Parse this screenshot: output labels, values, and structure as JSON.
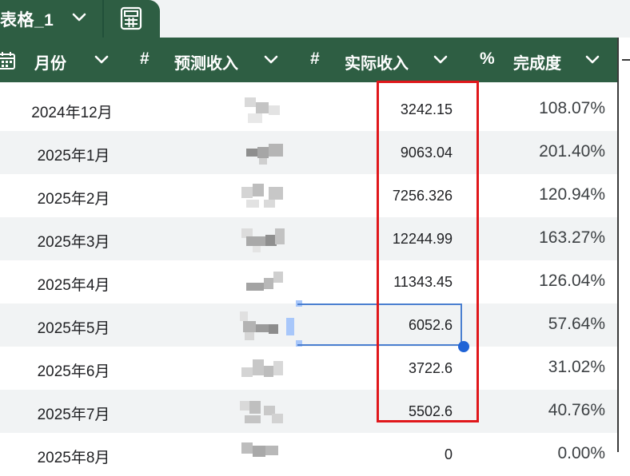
{
  "tab": {
    "name": "表格_1",
    "chevron_icon": "chevron-down-icon",
    "calc_icon": "calculator-icon"
  },
  "columns": [
    {
      "type_icon": "calendar-icon",
      "label": "月份"
    },
    {
      "type_icon": "#",
      "label": "预测收入"
    },
    {
      "type_icon": "#",
      "label": "实际收入"
    },
    {
      "type_icon": "%",
      "label": "完成度"
    }
  ],
  "rows": [
    {
      "month": "2024年12月",
      "actual": "3242.15",
      "pct": "108.07%"
    },
    {
      "month": "2025年1月",
      "actual": "9063.04",
      "pct": "201.40%"
    },
    {
      "month": "2025年2月",
      "actual": "7256.326",
      "pct": "120.94%"
    },
    {
      "month": "2025年3月",
      "actual": "12244.99",
      "pct": "163.27%"
    },
    {
      "month": "2025年4月",
      "actual": "11343.45",
      "pct": "126.04%"
    },
    {
      "month": "2025年5月",
      "actual": "6052.6",
      "pct": "57.64%"
    },
    {
      "month": "2025年6月",
      "actual": "3722.6",
      "pct": "31.02%"
    },
    {
      "month": "2025年7月",
      "actual": "5502.6",
      "pct": "40.76%"
    },
    {
      "month": "2025年8月",
      "actual": "0",
      "pct": "0.00%"
    }
  ],
  "selection": {
    "row": "2025年5月",
    "column": "实际收入"
  },
  "colors": {
    "header": "#2e5e43",
    "highlight_box": "#e0171b",
    "selection": "#4a7fd0",
    "alt_row": "#f1f3f4"
  }
}
